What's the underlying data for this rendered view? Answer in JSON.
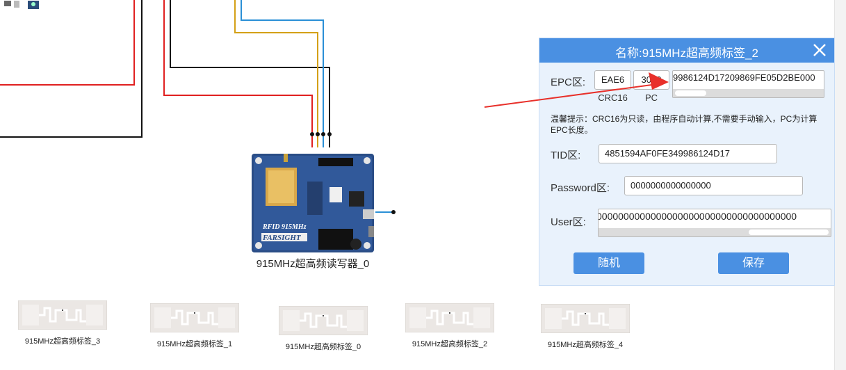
{
  "canvas": {
    "reader": {
      "label": "915MHz超高频读写器_0",
      "board_text_1": "RFID 915MHz",
      "board_text_2": "FARSIGHT"
    },
    "tags": [
      {
        "label": "915MHz超高频标签_3"
      },
      {
        "label": "915MHz超高频标签_1"
      },
      {
        "label": "915MHz超高频标签_0"
      },
      {
        "label": "915MHz超高频标签_2"
      },
      {
        "label": "915MHz超高频标签_4"
      }
    ],
    "wire_colors": {
      "red": "#e02020",
      "black": "#111111",
      "orange": "#d4a017",
      "blue": "#2a8fd6"
    }
  },
  "dialog": {
    "title": "名称:915MHz超高频标签_2",
    "epc": {
      "label": "EPC区:",
      "crc16_value": "EAE6",
      "crc16_label": "CRC16",
      "pc_value": "3000",
      "pc_label": "PC",
      "epc_value": "9986124D17209869FE05D2BE000"
    },
    "hint": "温馨提示：CRC16为只读，由程序自动计算,不需要手动输入，PC为计算EPC长度。",
    "tid": {
      "label": "TID区:",
      "value": "4851594AF0FE349986124D17"
    },
    "password": {
      "label": "Password区:",
      "value": "0000000000000000"
    },
    "user": {
      "label": "User区:",
      "value": "0000000000000000000000000000000000000"
    },
    "buttons": {
      "random": "随机",
      "save": "保存"
    },
    "accent": "#4a90e2",
    "arrow_color": "#e8302a"
  }
}
